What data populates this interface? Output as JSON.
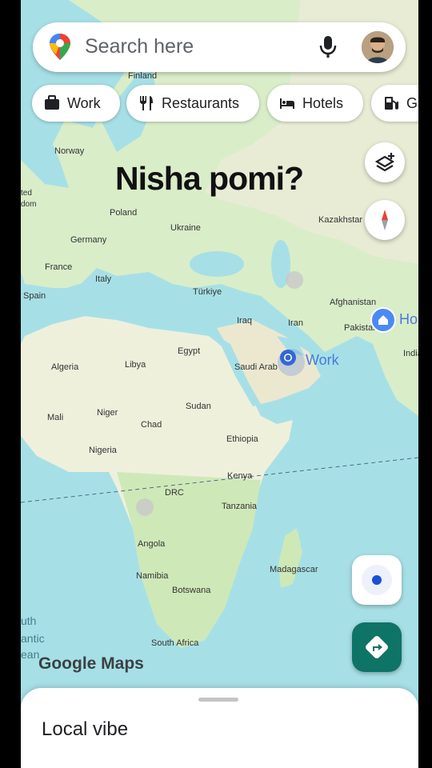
{
  "search": {
    "placeholder": "Search here"
  },
  "chips": [
    "Work",
    "Restaurants",
    "Hotels",
    "Ga"
  ],
  "overlay": {
    "caption": "Nisha pomi?"
  },
  "map": {
    "work_pin_label": "Work",
    "home_pin_label": "Ho",
    "watermark": "Google Maps",
    "labels": [
      "Finland",
      "Norway",
      "Poland",
      "Ukraine",
      "Kazakhstar",
      "Germany",
      "France",
      "Italy",
      "Spain",
      "Türkiye",
      "Afghanistan",
      "Iraq",
      "Iran",
      "Pakistan",
      "Egypt",
      "India",
      "Algeria",
      "Libya",
      "Saudi Arab",
      "Sudan",
      "Niger",
      "Mali",
      "Chad",
      "Ethiopia",
      "Nigeria",
      "Kenya",
      "DRC",
      "Tanzania",
      "Angola",
      "Madagascar",
      "Namibia",
      "Botswana",
      "South Africa",
      "ted",
      "dom",
      "uth",
      "antic",
      "ean"
    ]
  },
  "sheet": {
    "title": "Local vibe"
  },
  "colors": {
    "accent": "#1a73e8",
    "directions_fab": "#0e7466",
    "water": "#a6e0e6"
  }
}
